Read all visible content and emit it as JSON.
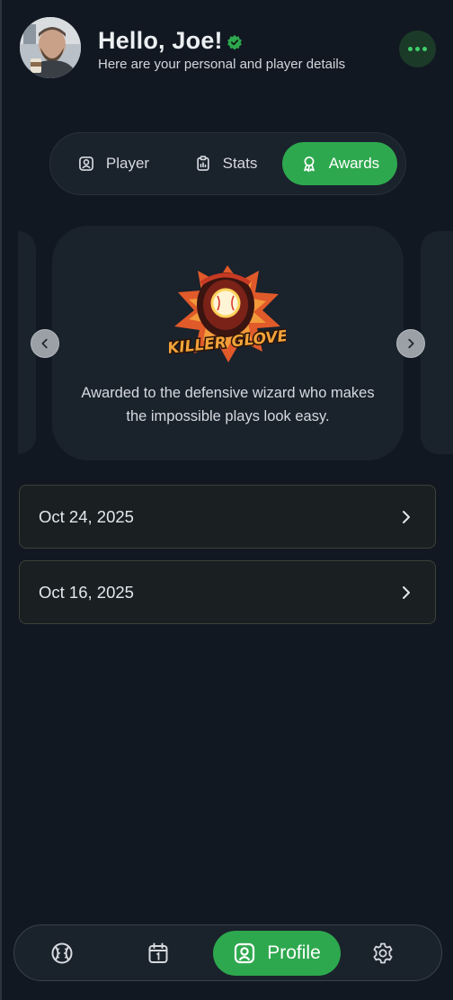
{
  "header": {
    "greeting": "Hello, Joe!",
    "subtitle": "Here are your personal and player details",
    "verified_icon": "verified-badge-icon",
    "menu_icon": "more-dots-icon",
    "accent_color": "#2ea84e"
  },
  "tabs": [
    {
      "label": "Player",
      "icon": "user-badge-icon",
      "active": false
    },
    {
      "label": "Stats",
      "icon": "clipboard-icon",
      "active": false
    },
    {
      "label": "Awards",
      "icon": "ribbon-award-icon",
      "active": true
    }
  ],
  "award": {
    "badge_text": "KILLER GLOVE",
    "description": "Awarded to the defensive wizard who makes the impossible plays look easy.",
    "prev_icon": "chevron-left-icon",
    "next_icon": "chevron-right-icon"
  },
  "award_dates": [
    {
      "date": "Oct 24, 2025",
      "icon": "chevron-right-icon"
    },
    {
      "date": "Oct 16, 2025",
      "icon": "chevron-right-icon"
    }
  ],
  "bottom_nav": [
    {
      "icon": "baseball-icon",
      "label": "",
      "active": false
    },
    {
      "icon": "calendar-icon",
      "label": "",
      "active": false
    },
    {
      "icon": "profile-icon",
      "label": "Profile",
      "active": true
    },
    {
      "icon": "gear-icon",
      "label": "",
      "active": false
    }
  ]
}
